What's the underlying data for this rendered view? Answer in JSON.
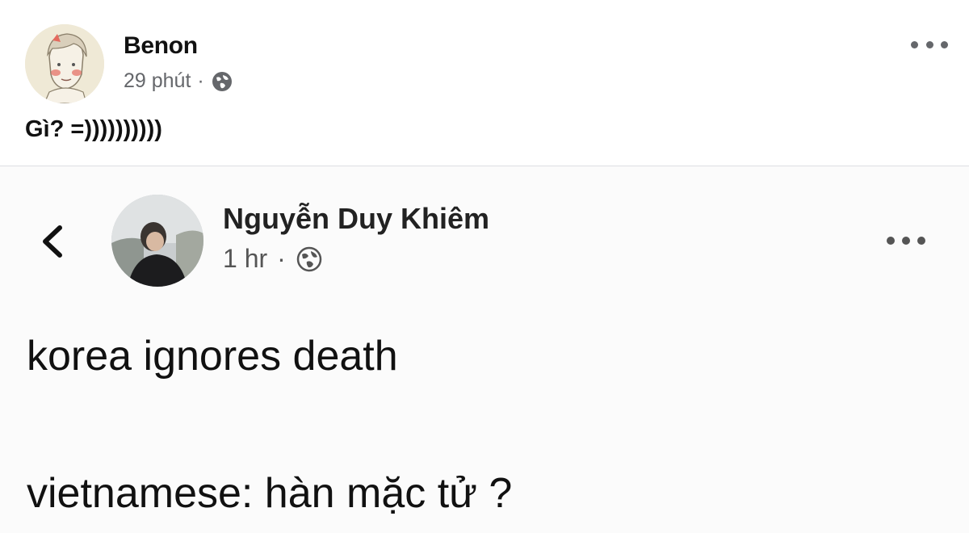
{
  "post": {
    "author": "Benon",
    "time": "29 phút",
    "separator": "·",
    "privacy_icon": "globe-icon",
    "text": "Gì? =))))))))))"
  },
  "shared": {
    "author": "Nguyễn Duy Khiêm",
    "time": "1 hr",
    "separator": "·",
    "privacy_icon": "globe-icon",
    "back_icon": "chevron-left-icon",
    "line1": "korea ignores death",
    "line2": "vietnamese: hàn mặc tử ?"
  },
  "colors": {
    "meta_gray": "#65676b",
    "text": "#111111",
    "divider": "#dddfe2"
  }
}
